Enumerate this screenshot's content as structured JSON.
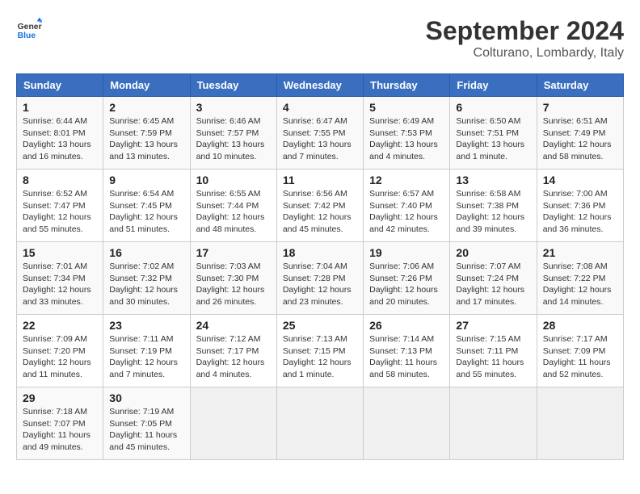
{
  "header": {
    "logo_line1": "General",
    "logo_line2": "Blue",
    "month": "September 2024",
    "location": "Colturano, Lombardy, Italy"
  },
  "weekdays": [
    "Sunday",
    "Monday",
    "Tuesday",
    "Wednesday",
    "Thursday",
    "Friday",
    "Saturday"
  ],
  "weeks": [
    [
      {
        "day": "1",
        "info": "Sunrise: 6:44 AM\nSunset: 8:01 PM\nDaylight: 13 hours\nand 16 minutes."
      },
      {
        "day": "2",
        "info": "Sunrise: 6:45 AM\nSunset: 7:59 PM\nDaylight: 13 hours\nand 13 minutes."
      },
      {
        "day": "3",
        "info": "Sunrise: 6:46 AM\nSunset: 7:57 PM\nDaylight: 13 hours\nand 10 minutes."
      },
      {
        "day": "4",
        "info": "Sunrise: 6:47 AM\nSunset: 7:55 PM\nDaylight: 13 hours\nand 7 minutes."
      },
      {
        "day": "5",
        "info": "Sunrise: 6:49 AM\nSunset: 7:53 PM\nDaylight: 13 hours\nand 4 minutes."
      },
      {
        "day": "6",
        "info": "Sunrise: 6:50 AM\nSunset: 7:51 PM\nDaylight: 13 hours\nand 1 minute."
      },
      {
        "day": "7",
        "info": "Sunrise: 6:51 AM\nSunset: 7:49 PM\nDaylight: 12 hours\nand 58 minutes."
      }
    ],
    [
      {
        "day": "8",
        "info": "Sunrise: 6:52 AM\nSunset: 7:47 PM\nDaylight: 12 hours\nand 55 minutes."
      },
      {
        "day": "9",
        "info": "Sunrise: 6:54 AM\nSunset: 7:45 PM\nDaylight: 12 hours\nand 51 minutes."
      },
      {
        "day": "10",
        "info": "Sunrise: 6:55 AM\nSunset: 7:44 PM\nDaylight: 12 hours\nand 48 minutes."
      },
      {
        "day": "11",
        "info": "Sunrise: 6:56 AM\nSunset: 7:42 PM\nDaylight: 12 hours\nand 45 minutes."
      },
      {
        "day": "12",
        "info": "Sunrise: 6:57 AM\nSunset: 7:40 PM\nDaylight: 12 hours\nand 42 minutes."
      },
      {
        "day": "13",
        "info": "Sunrise: 6:58 AM\nSunset: 7:38 PM\nDaylight: 12 hours\nand 39 minutes."
      },
      {
        "day": "14",
        "info": "Sunrise: 7:00 AM\nSunset: 7:36 PM\nDaylight: 12 hours\nand 36 minutes."
      }
    ],
    [
      {
        "day": "15",
        "info": "Sunrise: 7:01 AM\nSunset: 7:34 PM\nDaylight: 12 hours\nand 33 minutes."
      },
      {
        "day": "16",
        "info": "Sunrise: 7:02 AM\nSunset: 7:32 PM\nDaylight: 12 hours\nand 30 minutes."
      },
      {
        "day": "17",
        "info": "Sunrise: 7:03 AM\nSunset: 7:30 PM\nDaylight: 12 hours\nand 26 minutes."
      },
      {
        "day": "18",
        "info": "Sunrise: 7:04 AM\nSunset: 7:28 PM\nDaylight: 12 hours\nand 23 minutes."
      },
      {
        "day": "19",
        "info": "Sunrise: 7:06 AM\nSunset: 7:26 PM\nDaylight: 12 hours\nand 20 minutes."
      },
      {
        "day": "20",
        "info": "Sunrise: 7:07 AM\nSunset: 7:24 PM\nDaylight: 12 hours\nand 17 minutes."
      },
      {
        "day": "21",
        "info": "Sunrise: 7:08 AM\nSunset: 7:22 PM\nDaylight: 12 hours\nand 14 minutes."
      }
    ],
    [
      {
        "day": "22",
        "info": "Sunrise: 7:09 AM\nSunset: 7:20 PM\nDaylight: 12 hours\nand 11 minutes."
      },
      {
        "day": "23",
        "info": "Sunrise: 7:11 AM\nSunset: 7:19 PM\nDaylight: 12 hours\nand 7 minutes."
      },
      {
        "day": "24",
        "info": "Sunrise: 7:12 AM\nSunset: 7:17 PM\nDaylight: 12 hours\nand 4 minutes."
      },
      {
        "day": "25",
        "info": "Sunrise: 7:13 AM\nSunset: 7:15 PM\nDaylight: 12 hours\nand 1 minute."
      },
      {
        "day": "26",
        "info": "Sunrise: 7:14 AM\nSunset: 7:13 PM\nDaylight: 11 hours\nand 58 minutes."
      },
      {
        "day": "27",
        "info": "Sunrise: 7:15 AM\nSunset: 7:11 PM\nDaylight: 11 hours\nand 55 minutes."
      },
      {
        "day": "28",
        "info": "Sunrise: 7:17 AM\nSunset: 7:09 PM\nDaylight: 11 hours\nand 52 minutes."
      }
    ],
    [
      {
        "day": "29",
        "info": "Sunrise: 7:18 AM\nSunset: 7:07 PM\nDaylight: 11 hours\nand 49 minutes."
      },
      {
        "day": "30",
        "info": "Sunrise: 7:19 AM\nSunset: 7:05 PM\nDaylight: 11 hours\nand 45 minutes."
      },
      {
        "day": "",
        "info": ""
      },
      {
        "day": "",
        "info": ""
      },
      {
        "day": "",
        "info": ""
      },
      {
        "day": "",
        "info": ""
      },
      {
        "day": "",
        "info": ""
      }
    ]
  ]
}
